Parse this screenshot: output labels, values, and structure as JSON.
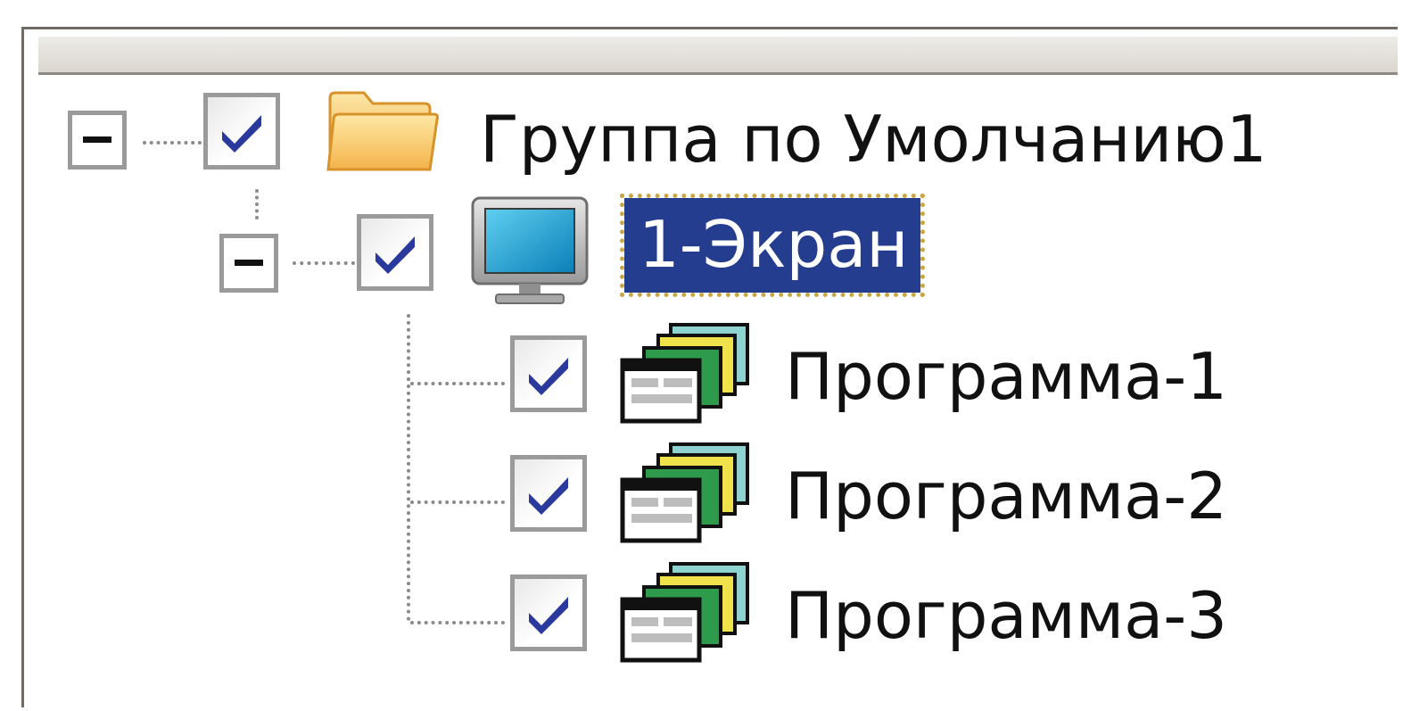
{
  "window": {
    "header_label": ""
  },
  "tree": {
    "root": {
      "label": "Группа по Умолчанию1",
      "checked": true,
      "expanded": true,
      "icon": "folder-icon"
    },
    "screen": {
      "label": "1-Экран",
      "checked": true,
      "expanded": true,
      "selected": true,
      "icon": "monitor-icon"
    },
    "programs": [
      {
        "label": "Программа-1",
        "checked": true,
        "icon": "program-stack-icon"
      },
      {
        "label": "Программа-2",
        "checked": true,
        "icon": "program-stack-icon"
      },
      {
        "label": "Программа-3",
        "checked": true,
        "icon": "program-stack-icon"
      }
    ]
  },
  "colors": {
    "selection_bg": "#243d8f",
    "selection_focus": "#c8a844",
    "check": "#2a3a9c",
    "folder": "#f2b544"
  }
}
